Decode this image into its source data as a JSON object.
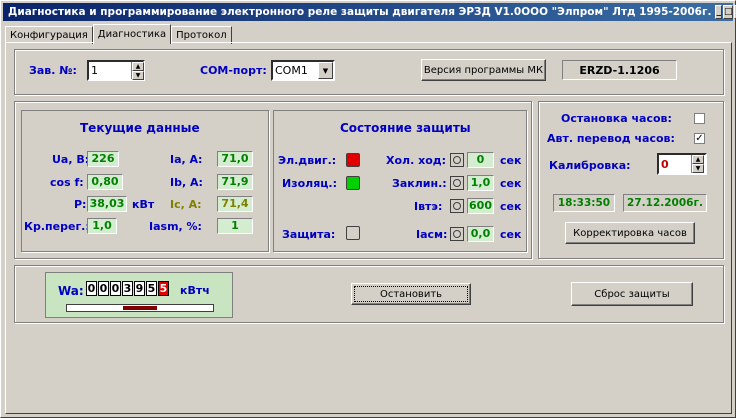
{
  "window": {
    "title": "Диагностика и программирование электронного реле защиты двигателя ЭРЗД   V1.0",
    "company": "ООО \"Элпром\" Лтд  1995-2006г.",
    "minimize": "_",
    "maximize": "□",
    "close": "✕"
  },
  "tabs": [
    {
      "label": "Конфигурация"
    },
    {
      "label": "Диагностика"
    },
    {
      "label": "Протокол"
    }
  ],
  "top": {
    "serial_label": "Зав. №:",
    "serial_value": "1",
    "com_label": "COM-порт:",
    "com_value": "COM1",
    "version_button": "Версия программы МК",
    "version_value": "ERZD-1.1206"
  },
  "current": {
    "title": "Текущие данные",
    "ua_label": "Ua, В:",
    "ua_value": "226",
    "ia_label": "Ia, А:",
    "ia_value": "71,0",
    "cos_label": "cos f:",
    "cos_value": "0,80",
    "ib_label": "Ib, А:",
    "ib_value": "71,9",
    "p_label": "P:",
    "p_value": "38,03",
    "p_unit": "кВт",
    "ic_label": "Ic, А:",
    "ic_value": "71,4",
    "kr_label": "Кр.перег.:",
    "kr_value": "1,0",
    "iasm_label": "Iasm, %:",
    "iasm_value": "1"
  },
  "protection": {
    "title": "Состояние защиты",
    "motor_label": "Эл.двиг.:",
    "motor_color": "#e00000",
    "insul_label": "Изоляц.:",
    "insul_color": "#00d000",
    "prot_label": "Защита:",
    "idle_label": "Хол. ход:",
    "idle_value": "0",
    "idle_unit": "сек",
    "jam_label": "Заклин.:",
    "jam_value": "1,0",
    "jam_unit": "сек",
    "ite_label": "Iвтэ:",
    "ite_value": "600",
    "ite_unit": "сек",
    "iasm_label": "Iасм:",
    "iasm_value": "0,0",
    "iasm_unit": "сек"
  },
  "clock": {
    "stop_label": "Остановка часов:",
    "stop_checked": "",
    "auto_label": "Авт. перевод часов:",
    "auto_checked": "✓",
    "cal_label": "Калибровка:",
    "cal_value": "0",
    "time": "18:33:50",
    "date": "27.12.2006г.",
    "adjust_button": "Корректировка часов"
  },
  "bottom": {
    "wa_label": "Wa:",
    "digits": [
      "0",
      "0",
      "0",
      "3",
      "9",
      "5",
      "5"
    ],
    "wa_unit": "кВтч",
    "stop_button": "Остановить",
    "reset_button": "Сброс защиты"
  }
}
